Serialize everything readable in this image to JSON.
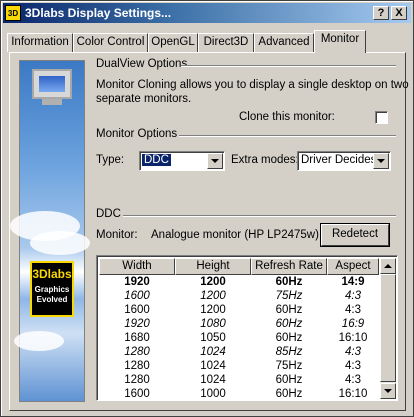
{
  "window": {
    "title": "3Dlabs Display Settings...",
    "app_icon": "3D",
    "help_label": "?",
    "close_label": "X"
  },
  "tabs": [
    {
      "label": "Information"
    },
    {
      "label": "Color Control"
    },
    {
      "label": "OpenGL"
    },
    {
      "label": "Direct3D"
    },
    {
      "label": "Advanced"
    },
    {
      "label": "Monitor",
      "active": true
    }
  ],
  "logo": {
    "brand": "3Dlabs",
    "line1": "Graphics",
    "line2": "Evolved"
  },
  "dualview": {
    "heading": "DualView Options",
    "description_line1": "Monitor Cloning allows you to display a single desktop on two",
    "description_line2": "separate monitors.",
    "clone_label": "Clone this monitor:",
    "clone_checked": false
  },
  "monitor_options": {
    "heading": "Monitor Options",
    "type_label": "Type:",
    "type_value": "DDC",
    "extra_modes_label": "Extra modes:",
    "extra_modes_value": "Driver Decides"
  },
  "ddc": {
    "heading": "DDC",
    "monitor_label": "Monitor:",
    "monitor_value": "Analogue monitor (HP LP2475w)",
    "redetect_label": "Redetect"
  },
  "modes_table": {
    "columns": [
      "Width",
      "Height",
      "Refresh Rate",
      "Aspect"
    ],
    "rows": [
      {
        "width": "1920",
        "height": "1200",
        "refresh": "60Hz",
        "aspect": "14:9",
        "style": "bold"
      },
      {
        "width": "1600",
        "height": "1200",
        "refresh": "75Hz",
        "aspect": "4:3",
        "style": "italic"
      },
      {
        "width": "1600",
        "height": "1200",
        "refresh": "60Hz",
        "aspect": "4:3",
        "style": "normal"
      },
      {
        "width": "1920",
        "height": "1080",
        "refresh": "60Hz",
        "aspect": "16:9",
        "style": "italic"
      },
      {
        "width": "1680",
        "height": "1050",
        "refresh": "60Hz",
        "aspect": "16:10",
        "style": "normal"
      },
      {
        "width": "1280",
        "height": "1024",
        "refresh": "85Hz",
        "aspect": "4:3",
        "style": "italic"
      },
      {
        "width": "1280",
        "height": "1024",
        "refresh": "75Hz",
        "aspect": "4:3",
        "style": "normal"
      },
      {
        "width": "1280",
        "height": "1024",
        "refresh": "60Hz",
        "aspect": "4:3",
        "style": "normal"
      },
      {
        "width": "1600",
        "height": "1000",
        "refresh": "60Hz",
        "aspect": "16:10",
        "style": "normal"
      }
    ]
  }
}
